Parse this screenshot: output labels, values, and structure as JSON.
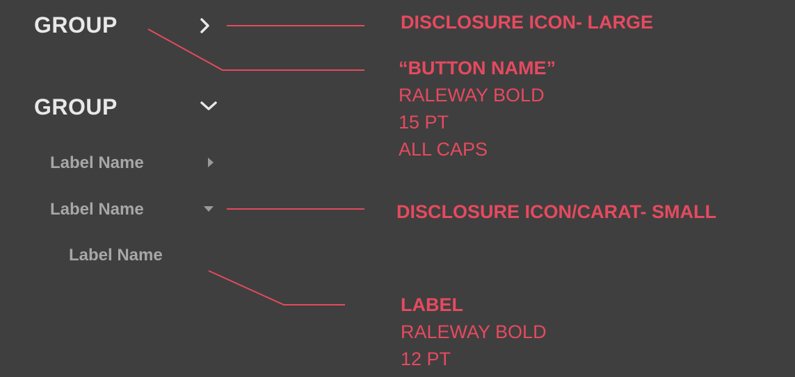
{
  "tree": {
    "group_collapsed": {
      "label": "GROUP",
      "icon": "chevron-right-icon"
    },
    "group_expanded": {
      "label": "GROUP",
      "icon": "chevron-down-icon"
    },
    "label_collapsed": {
      "label": "Label Name",
      "icon": "caret-right-icon"
    },
    "label_expanded": {
      "label": "Label Name",
      "icon": "caret-down-icon"
    },
    "label_child": {
      "label": "Label Name"
    }
  },
  "annotations": {
    "disclosure_large": {
      "title": "DISCLOSURE ICON- LARGE"
    },
    "button_name": {
      "title": "“BUTTON NAME”",
      "lines": [
        "RALEWAY BOLD",
        "15 PT",
        "ALL CAPS"
      ]
    },
    "disclosure_small": {
      "title": "DISCLOSURE ICON/CARAT- SMALL"
    },
    "label": {
      "title": "LABEL",
      "lines": [
        "RALEWAY BOLD",
        "12 PT"
      ]
    }
  },
  "colors": {
    "background": "#3f3f3f",
    "group_text": "#e8e8e8",
    "label_text": "#a7a7a7",
    "accent": "#e64a5f"
  }
}
